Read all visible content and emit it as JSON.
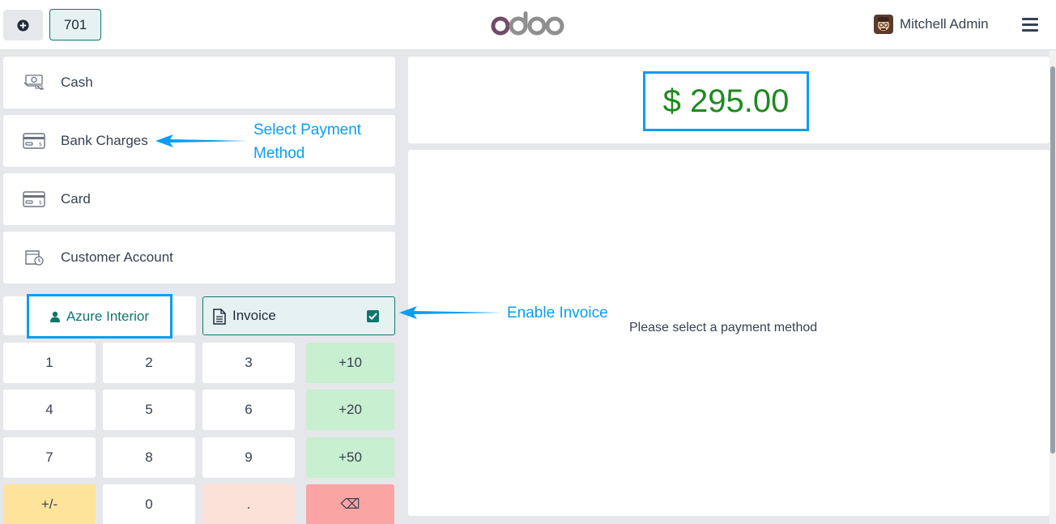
{
  "header": {
    "order_number": "701",
    "logo_text": "odoo",
    "user_name": "Mitchell Admin"
  },
  "payment_methods": [
    {
      "label": "Cash",
      "icon": "cash-icon"
    },
    {
      "label": "Bank Charges",
      "icon": "card-icon"
    },
    {
      "label": "Card",
      "icon": "card-icon"
    },
    {
      "label": "Customer Account",
      "icon": "wallet-clock-icon"
    }
  ],
  "customer": {
    "label": "Azure Interior"
  },
  "invoice": {
    "label": "Invoice",
    "checked": true
  },
  "keypad": {
    "keys": [
      "1",
      "2",
      "3",
      "+10",
      "4",
      "5",
      "6",
      "+20",
      "7",
      "8",
      "9",
      "+50",
      "+/-",
      "0",
      ".",
      "⌫"
    ]
  },
  "total": {
    "amount": "$ 295.00"
  },
  "payment_hint": "Please select a payment method",
  "annotations": {
    "select_payment": "Select Payment Method",
    "select_payment_line1": "Select Payment",
    "select_payment_line2": "Method",
    "enable_invoice": "Enable Invoice"
  },
  "colors": {
    "accent": "#0f766e",
    "highlight": "#0a9df0",
    "total": "#1e8a1e"
  }
}
